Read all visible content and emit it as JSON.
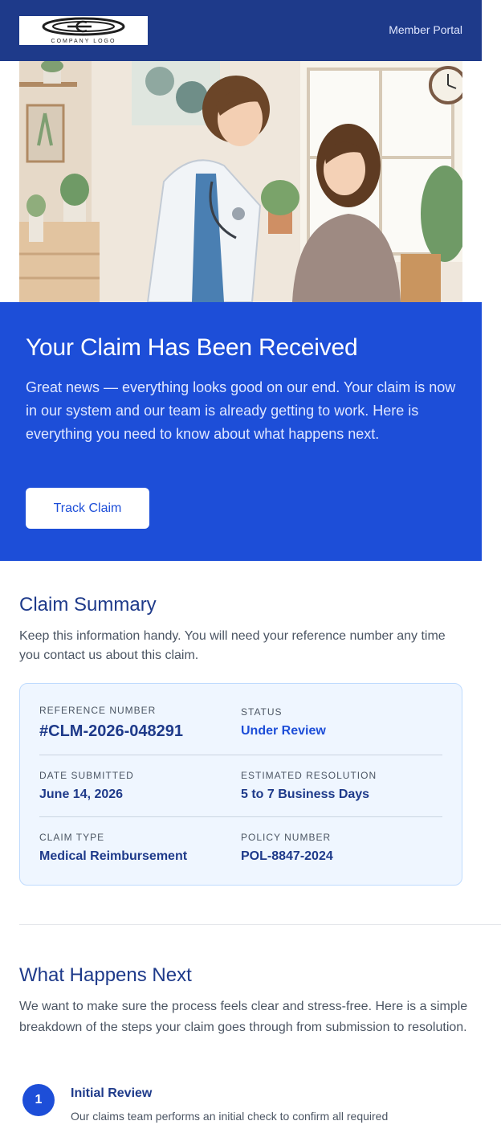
{
  "header": {
    "logo_text": "COMPANY LOGO",
    "portal_link": "Member Portal"
  },
  "hero": {
    "image": "doctor-and-patient-illustration",
    "title": "Your Claim Has Been Received",
    "body": "Great news — everything looks good on our end. Your claim is now in our system and our team is already getting to work. Here is everything you need to know about what happens next.",
    "button_label": "Track Claim"
  },
  "summary": {
    "title": "Claim Summary",
    "intro": "Keep this information handy. You will need your reference number any time you contact us about this claim.",
    "fields": {
      "reference_label": "REFERENCE NUMBER",
      "reference_value": "#CLM-2026-048291",
      "status_label": "STATUS",
      "status_value": "Under Review",
      "date_label": "DATE SUBMITTED",
      "date_value": "June 14, 2026",
      "resolution_label": "ESTIMATED RESOLUTION",
      "resolution_value": "5 to 7 Business Days",
      "type_label": "CLAIM TYPE",
      "type_value": "Medical Reimbursement",
      "policy_label": "POLICY NUMBER",
      "policy_value": "POL-8847-2024"
    }
  },
  "next": {
    "title": "What Happens Next",
    "intro": "We want to make sure the process feels clear and stress-free. Here is a simple breakdown of the steps your claim goes through from submission to resolution.",
    "steps": [
      {
        "number": "1",
        "title": "Initial Review",
        "description": "Our claims team performs an initial check to confirm all required"
      }
    ]
  },
  "colors": {
    "header_bg": "#1e3a8a",
    "banner_bg": "#1d4ed8",
    "card_bg": "#eff6ff",
    "heading": "#1e3a8a"
  }
}
